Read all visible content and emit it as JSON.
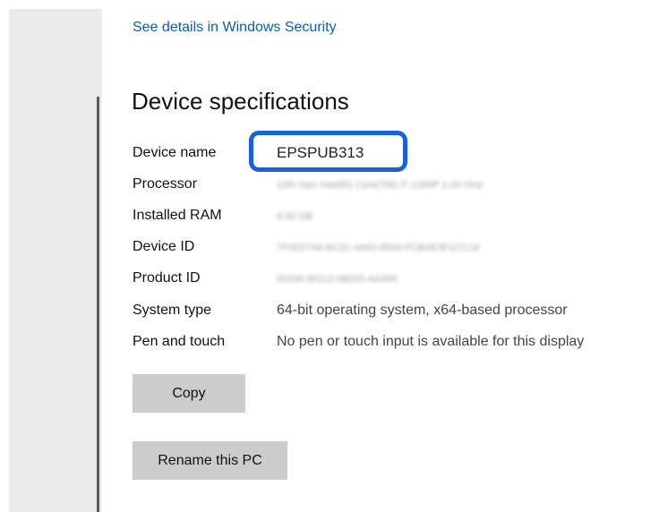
{
  "security": {
    "link_label": "See details in Windows Security"
  },
  "specs": {
    "title": "Device specifications",
    "rows": [
      {
        "label": "Device name",
        "value": "EPSPUB313"
      },
      {
        "label": "Processor",
        "value": "12th Gen Intel(R) Core(TM) i7-1280P   2.00 GHz"
      },
      {
        "label": "Installed RAM",
        "value": "4.00 GB"
      },
      {
        "label": "Device ID",
        "value": "7F0D2746-8C2C-4493-9509-FCBAE5F1CC16"
      },
      {
        "label": "Product ID",
        "value": "00330-80112-68025-AA305"
      },
      {
        "label": "System type",
        "value": "64-bit operating system, x64-based processor"
      },
      {
        "label": "Pen and touch",
        "value": "No pen or touch input is available for this display"
      }
    ]
  },
  "actions": {
    "copy_label": "Copy",
    "rename_label": "Rename this PC"
  },
  "colors": {
    "link": "#0a5fb0",
    "highlight_border": "#1a5fdc",
    "button_bg": "#cccccc",
    "nav_bg": "#ebebeb"
  }
}
